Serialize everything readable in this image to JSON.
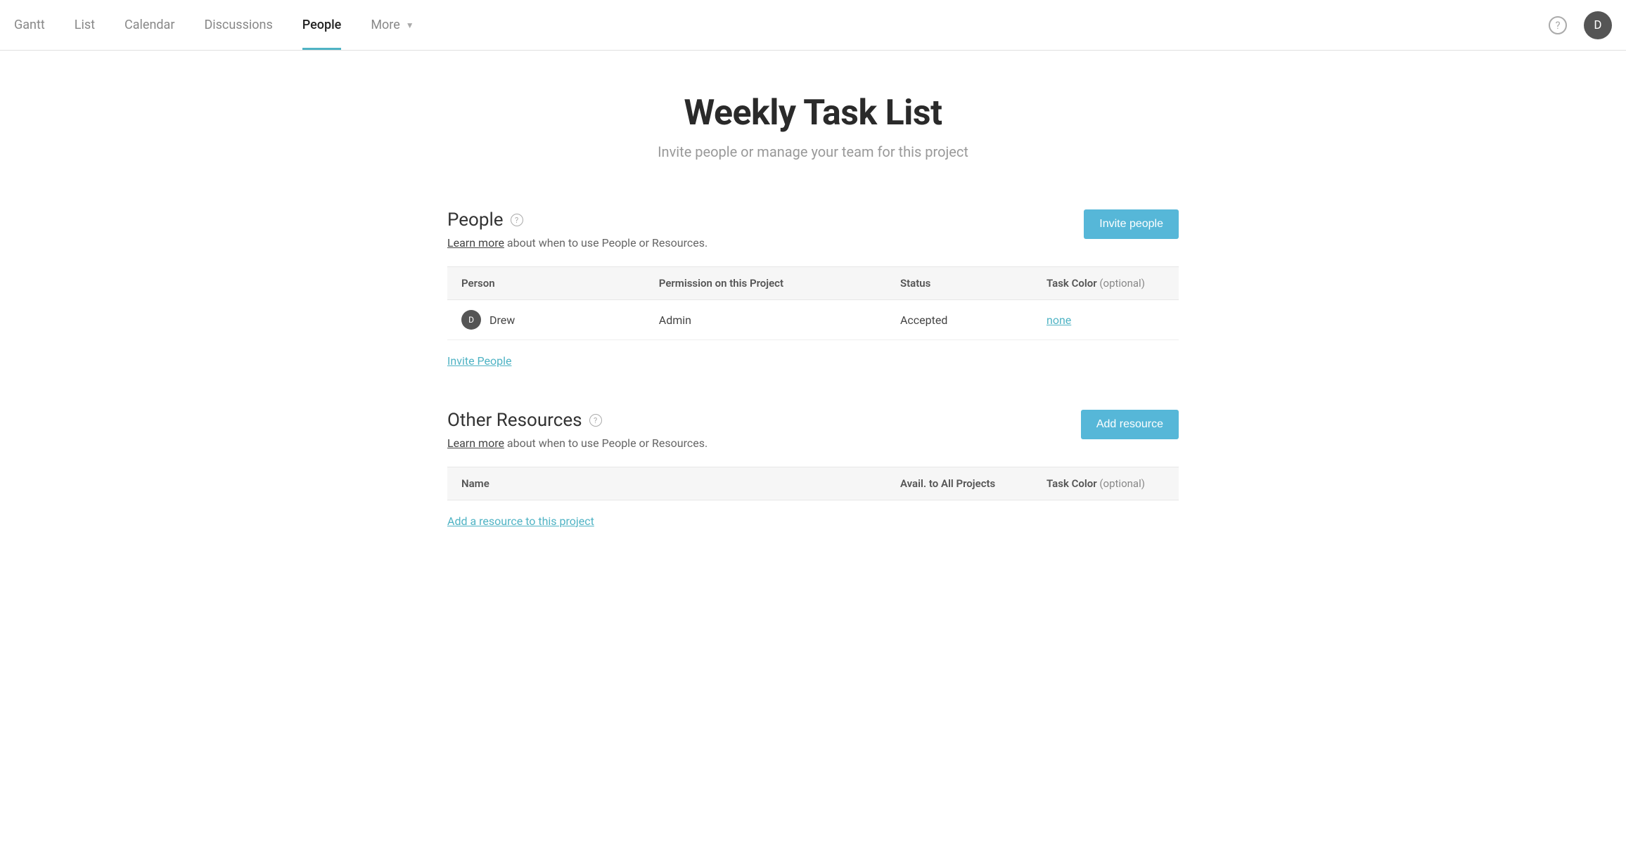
{
  "nav": {
    "tabs": [
      {
        "label": "Gantt",
        "active": false
      },
      {
        "label": "List",
        "active": false
      },
      {
        "label": "Calendar",
        "active": false
      },
      {
        "label": "Discussions",
        "active": false
      },
      {
        "label": "People",
        "active": true
      },
      {
        "label": "More",
        "active": false,
        "dropdown": true
      }
    ],
    "help_glyph": "?",
    "avatar_letter": "D"
  },
  "page": {
    "title": "Weekly Task List",
    "subtitle": "Invite people or manage your team for this project"
  },
  "people_section": {
    "title": "People",
    "help_glyph": "?",
    "hint_link": "Learn more",
    "hint_text": " about when to use People or Resources.",
    "button": "Invite people",
    "columns": {
      "person": "Person",
      "permission": "Permission on this Project",
      "status": "Status",
      "task_color": "Task Color",
      "optional": " (optional)"
    },
    "rows": [
      {
        "avatar": "D",
        "name": "Drew",
        "permission": "Admin",
        "status": "Accepted",
        "task_color": "none"
      }
    ],
    "footer_link": "Invite People"
  },
  "resources_section": {
    "title": "Other Resources",
    "help_glyph": "?",
    "hint_link": "Learn more",
    "hint_text": " about when to use People or Resources.",
    "button": "Add resource",
    "columns": {
      "name": "Name",
      "avail": "Avail. to All Projects",
      "task_color": "Task Color",
      "optional": " (optional)"
    },
    "footer_link": "Add a resource to this project"
  }
}
